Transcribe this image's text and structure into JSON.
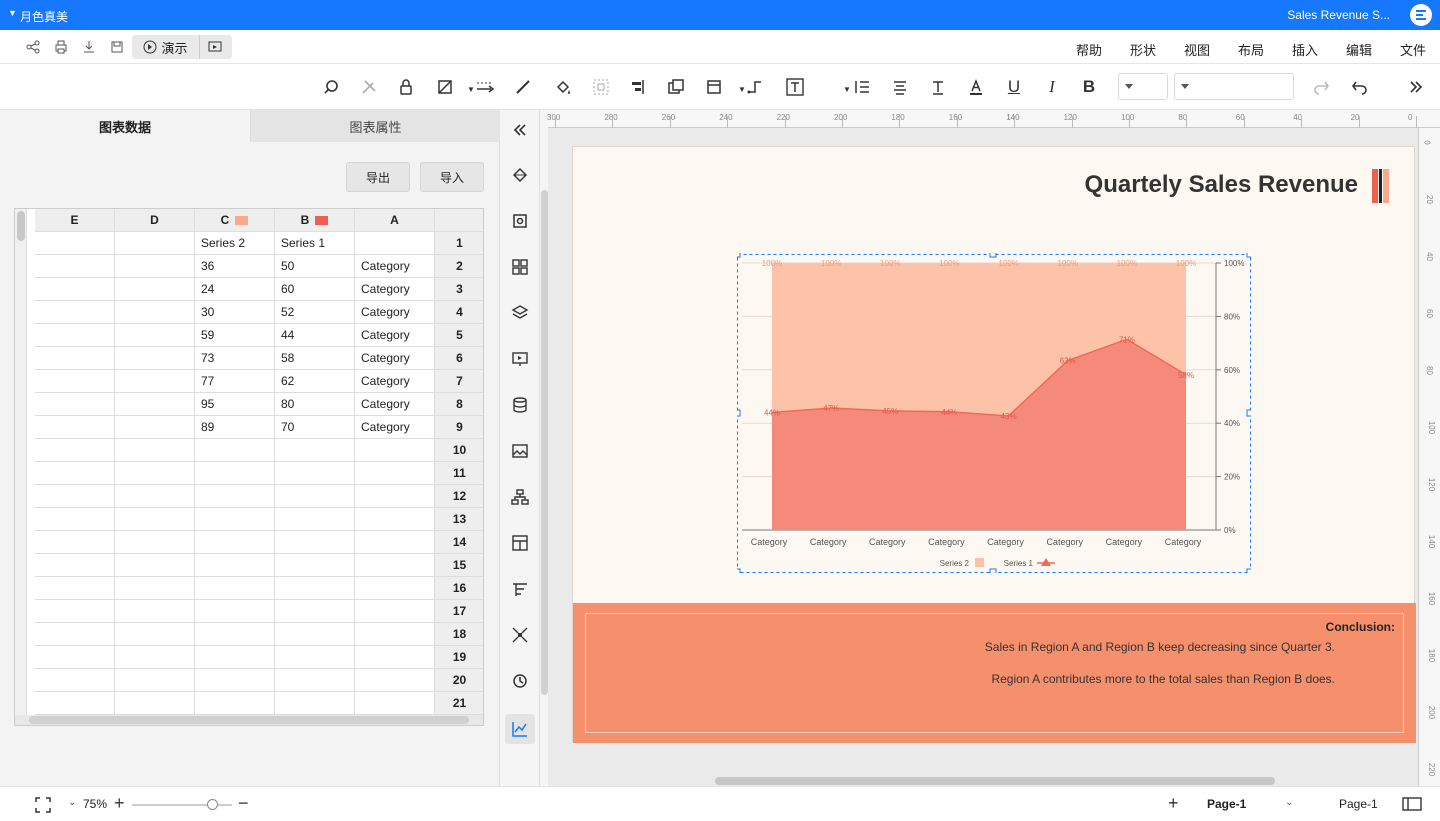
{
  "titlebar": {
    "doc_title": "Sales Revenue S...",
    "theme": "月色真美"
  },
  "menu": {
    "items": [
      "文件",
      "编辑",
      "插入",
      "布局",
      "视图",
      "形状",
      "帮助"
    ]
  },
  "presentation": {
    "label": "演示"
  },
  "toolbar": {
    "font_name": "",
    "font_size": ""
  },
  "left_panel": {
    "tab_data": "图表数据",
    "tab_props": "图表属性",
    "import_label": "导入",
    "export_label": "导出"
  },
  "sheet": {
    "columns": [
      "A",
      "B",
      "C",
      "D",
      "E"
    ],
    "col_colors": {
      "B": "#ef5f50",
      "C": "#f9a98e"
    },
    "rows": [
      {
        "n": "1",
        "A": "",
        "B": "Series 1",
        "C": "Series 2",
        "D": "",
        "E": ""
      },
      {
        "n": "2",
        "A": "Category",
        "B": "50",
        "C": "36",
        "D": "",
        "E": ""
      },
      {
        "n": "3",
        "A": "Category",
        "B": "60",
        "C": "24",
        "D": "",
        "E": ""
      },
      {
        "n": "4",
        "A": "Category",
        "B": "52",
        "C": "30",
        "D": "",
        "E": ""
      },
      {
        "n": "5",
        "A": "Category",
        "B": "44",
        "C": "59",
        "D": "",
        "E": ""
      },
      {
        "n": "6",
        "A": "Category",
        "B": "58",
        "C": "73",
        "D": "",
        "E": ""
      },
      {
        "n": "7",
        "A": "Category",
        "B": "62",
        "C": "77",
        "D": "",
        "E": ""
      },
      {
        "n": "8",
        "A": "Category",
        "B": "80",
        "C": "95",
        "D": "",
        "E": ""
      },
      {
        "n": "9",
        "A": "Category",
        "B": "70",
        "C": "89",
        "D": "",
        "E": ""
      },
      {
        "n": "10",
        "A": "",
        "B": "",
        "C": "",
        "D": "",
        "E": ""
      },
      {
        "n": "11",
        "A": "",
        "B": "",
        "C": "",
        "D": "",
        "E": ""
      },
      {
        "n": "12",
        "A": "",
        "B": "",
        "C": "",
        "D": "",
        "E": ""
      },
      {
        "n": "13",
        "A": "",
        "B": "",
        "C": "",
        "D": "",
        "E": ""
      },
      {
        "n": "14",
        "A": "",
        "B": "",
        "C": "",
        "D": "",
        "E": ""
      },
      {
        "n": "15",
        "A": "",
        "B": "",
        "C": "",
        "D": "",
        "E": ""
      },
      {
        "n": "16",
        "A": "",
        "B": "",
        "C": "",
        "D": "",
        "E": ""
      },
      {
        "n": "17",
        "A": "",
        "B": "",
        "C": "",
        "D": "",
        "E": ""
      },
      {
        "n": "18",
        "A": "",
        "B": "",
        "C": "",
        "D": "",
        "E": ""
      },
      {
        "n": "19",
        "A": "",
        "B": "",
        "C": "",
        "D": "",
        "E": ""
      },
      {
        "n": "20",
        "A": "",
        "B": "",
        "C": "",
        "D": "",
        "E": ""
      },
      {
        "n": "21",
        "A": "",
        "B": "",
        "C": "",
        "D": "",
        "E": ""
      }
    ]
  },
  "ruler": {
    "top_labels": [
      "0",
      "20",
      "40",
      "60",
      "80",
      "100",
      "120",
      "140",
      "160",
      "180",
      "200",
      "220",
      "240",
      "260",
      "280",
      "300"
    ],
    "side_labels": [
      "0",
      "20",
      "40",
      "60",
      "80",
      "100",
      "120",
      "140",
      "160",
      "180",
      "200",
      "220"
    ]
  },
  "slide": {
    "title": "Quartely Sales Revenue",
    "conclusion_title": "Conclusion:",
    "conclusion_lines": [
      "Sales in Region A and Region B keep decreasing since Quarter 3.",
      "Region A contributes more to the total sales than Region B does."
    ],
    "accent_colors": [
      "#ef5f50",
      "#f9a98e",
      "#f68f6b"
    ]
  },
  "chart_data": {
    "type": "area",
    "stacked_percent": true,
    "orientation": "mirrored",
    "categories": [
      "Category",
      "Category",
      "Category",
      "Category",
      "Category",
      "Category",
      "Category",
      "Category"
    ],
    "series": [
      {
        "name": "Series 1",
        "values": [
          50,
          60,
          52,
          44,
          58,
          62,
          80,
          70
        ],
        "percent_labels": [
          "58%",
          "71%",
          "63%",
          "43%",
          "44%",
          "45%",
          "47%",
          "44%"
        ],
        "color": "#f58a7a"
      },
      {
        "name": "Series 2",
        "values": [
          36,
          24,
          30,
          59,
          73,
          77,
          95,
          89
        ],
        "percent_labels": [
          "100%",
          "100%",
          "100%",
          "100%",
          "100%",
          "100%",
          "100%",
          "100%"
        ],
        "color": "#fcc3a8"
      }
    ],
    "y_axis": {
      "ticks": [
        "0%",
        "20%",
        "40%",
        "60%",
        "80%",
        "100%"
      ],
      "ylim": [
        0,
        100
      ],
      "position": "right"
    },
    "legend": {
      "position": "bottom",
      "entries": [
        "Series 1",
        "Series 2"
      ]
    },
    "grid": true
  },
  "statusbar": {
    "page_selector": "Page-1",
    "page_tab": "Page-1",
    "zoom": "75%"
  }
}
